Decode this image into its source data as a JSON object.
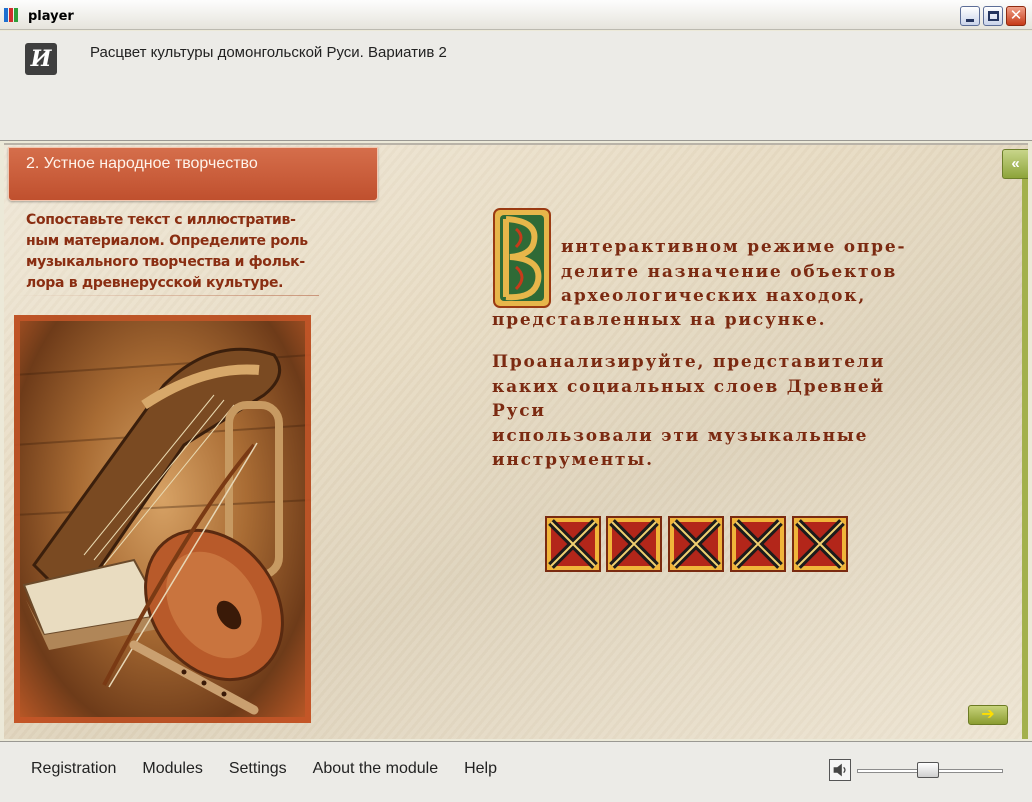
{
  "window": {
    "title": "player",
    "colors": {
      "icon_stripes": [
        "#1d6fd0",
        "#d12e2e",
        "#2e9e3a"
      ]
    }
  },
  "header": {
    "logo_text": "И",
    "course_title": "Расцвет культуры домонгольской Руси. Вариатив 2"
  },
  "content": {
    "section_title": "2. Устное народное творчество",
    "task_lines": [
      "Сопоставьте текст с иллюстратив-",
      "ным материалом. Определите роль",
      "музыкального творчества и фольк-",
      "лора в древнерусской культуре."
    ],
    "drop_cap_letter": "В",
    "paragraph1_lines_beside_cap": [
      "интерактивном режиме опре-",
      "делите назначение объектов",
      "археологических находок,"
    ],
    "paragraph1_last_line": "представленных на рисунке.",
    "paragraph2_lines": [
      "Проанализируйте, представители",
      "каких социальных слоев Древней Руси",
      "использовали эти музыкальные",
      "инструменты."
    ],
    "collapse_label": "«",
    "next_label": "➔",
    "colors": {
      "accent_text": "#7b2a11",
      "tab": "#c9593a",
      "nav_green": "#98ac3f"
    }
  },
  "footer": {
    "menu": [
      "Registration",
      "Modules",
      "Settings",
      "About the module",
      "Help"
    ],
    "volume_fraction": 0.48
  }
}
